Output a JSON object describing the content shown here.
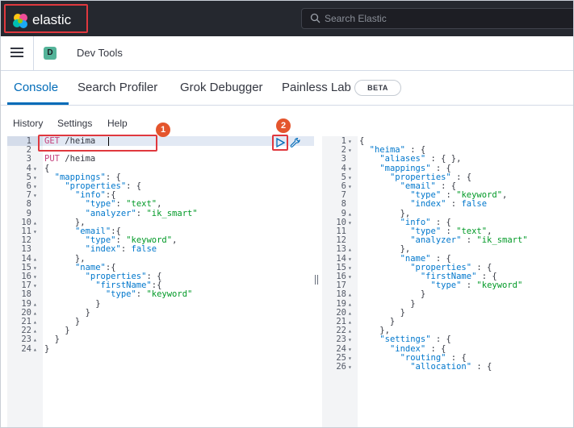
{
  "header": {
    "brand": "elastic",
    "search_placeholder": "Search Elastic"
  },
  "app": {
    "space_initial": "D",
    "breadcrumb": "Dev Tools"
  },
  "tabs": [
    {
      "label": "Console",
      "active": true
    },
    {
      "label": "Search Profiler",
      "active": false
    },
    {
      "label": "Grok Debugger",
      "active": false
    },
    {
      "label": "Painless Lab",
      "active": false
    }
  ],
  "beta_badge": "BETA",
  "console_menu": [
    "History",
    "Settings",
    "Help"
  ],
  "annotations": [
    "1",
    "2"
  ],
  "request_editor": {
    "lines": [
      {
        "n": "1",
        "f": "",
        "t": "GET /heima"
      },
      {
        "n": "2",
        "f": "",
        "t": ""
      },
      {
        "n": "3",
        "f": "",
        "t": "PUT /heima"
      },
      {
        "n": "4",
        "f": "▾",
        "t": "{"
      },
      {
        "n": "5",
        "f": "▾",
        "t": "  \"mappings\": {"
      },
      {
        "n": "6",
        "f": "▾",
        "t": "    \"properties\": {"
      },
      {
        "n": "7",
        "f": "▾",
        "t": "      \"info\":{"
      },
      {
        "n": "8",
        "f": "",
        "t": "        \"type\": \"text\","
      },
      {
        "n": "9",
        "f": "",
        "t": "        \"analyzer\": \"ik_smart\""
      },
      {
        "n": "10",
        "f": "▴",
        "t": "      },"
      },
      {
        "n": "11",
        "f": "▾",
        "t": "      \"email\":{"
      },
      {
        "n": "12",
        "f": "",
        "t": "        \"type\": \"keyword\","
      },
      {
        "n": "13",
        "f": "",
        "t": "        \"index\": false"
      },
      {
        "n": "14",
        "f": "▴",
        "t": "      },"
      },
      {
        "n": "15",
        "f": "▾",
        "t": "      \"name\":{"
      },
      {
        "n": "16",
        "f": "▾",
        "t": "        \"properties\": {"
      },
      {
        "n": "17",
        "f": "▾",
        "t": "          \"firstName\":{"
      },
      {
        "n": "18",
        "f": "",
        "t": "            \"type\": \"keyword\""
      },
      {
        "n": "19",
        "f": "▴",
        "t": "          }"
      },
      {
        "n": "20",
        "f": "▴",
        "t": "        }"
      },
      {
        "n": "21",
        "f": "▴",
        "t": "      }"
      },
      {
        "n": "22",
        "f": "▴",
        "t": "    }"
      },
      {
        "n": "23",
        "f": "▴",
        "t": "  }"
      },
      {
        "n": "24",
        "f": "▴",
        "t": "}"
      }
    ]
  },
  "response_editor": {
    "lines": [
      {
        "n": "1",
        "f": "▾",
        "t": "{"
      },
      {
        "n": "2",
        "f": "▾",
        "t": "  \"heima\" : {"
      },
      {
        "n": "3",
        "f": "",
        "t": "    \"aliases\" : { },"
      },
      {
        "n": "4",
        "f": "▾",
        "t": "    \"mappings\" : {"
      },
      {
        "n": "5",
        "f": "▾",
        "t": "      \"properties\" : {"
      },
      {
        "n": "6",
        "f": "▾",
        "t": "        \"email\" : {"
      },
      {
        "n": "7",
        "f": "",
        "t": "          \"type\" : \"keyword\","
      },
      {
        "n": "8",
        "f": "",
        "t": "          \"index\" : false"
      },
      {
        "n": "9",
        "f": "▴",
        "t": "        },"
      },
      {
        "n": "10",
        "f": "▾",
        "t": "        \"info\" : {"
      },
      {
        "n": "11",
        "f": "",
        "t": "          \"type\" : \"text\","
      },
      {
        "n": "12",
        "f": "",
        "t": "          \"analyzer\" : \"ik_smart\""
      },
      {
        "n": "13",
        "f": "▴",
        "t": "        },"
      },
      {
        "n": "14",
        "f": "▾",
        "t": "        \"name\" : {"
      },
      {
        "n": "15",
        "f": "▾",
        "t": "          \"properties\" : {"
      },
      {
        "n": "16",
        "f": "▾",
        "t": "            \"firstName\" : {"
      },
      {
        "n": "17",
        "f": "",
        "t": "              \"type\" : \"keyword\""
      },
      {
        "n": "18",
        "f": "▴",
        "t": "            }"
      },
      {
        "n": "19",
        "f": "▴",
        "t": "          }"
      },
      {
        "n": "20",
        "f": "▴",
        "t": "        }"
      },
      {
        "n": "21",
        "f": "▴",
        "t": "      }"
      },
      {
        "n": "22",
        "f": "▴",
        "t": "    },"
      },
      {
        "n": "23",
        "f": "▾",
        "t": "    \"settings\" : {"
      },
      {
        "n": "24",
        "f": "▾",
        "t": "      \"index\" : {"
      },
      {
        "n": "25",
        "f": "▾",
        "t": "        \"routing\" : {"
      },
      {
        "n": "26",
        "f": "▾",
        "t": "          \"allocation\" : {"
      }
    ]
  },
  "colors": {
    "topbar": "#25282f",
    "accent": "#006bb8",
    "annotation_red": "#e0383e",
    "annotation_badge": "#e4552d",
    "space_badge": "#54b399",
    "json_key": "#0077cc",
    "json_string": "#009926",
    "http_method": "#c4407c"
  }
}
